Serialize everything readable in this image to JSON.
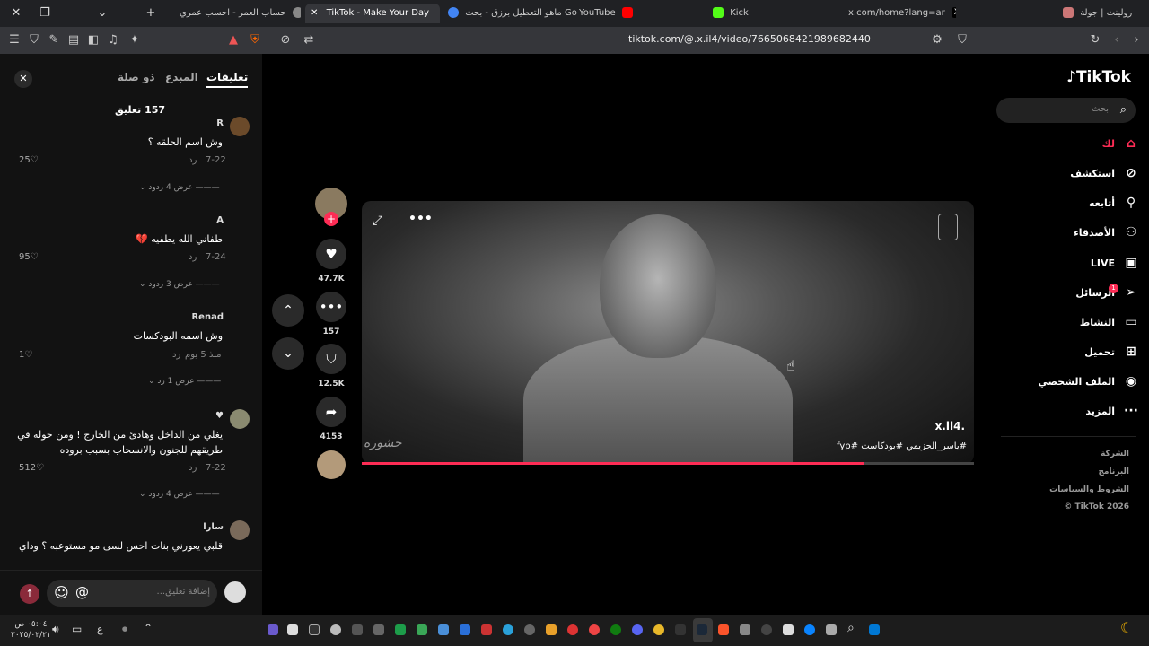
{
  "browser": {
    "tabs": [
      {
        "label": "رولينت | جولة",
        "icon": "globe-icon"
      },
      {
        "label": "x.com/home?lang=ar",
        "icon": "x-icon"
      },
      {
        "label": "Kick",
        "icon": "kick-icon"
      },
      {
        "label": "YouTube",
        "icon": "youtube-icon"
      },
      {
        "label": "ماهو التعطيل برزق - بحث Google",
        "icon": "google-icon"
      },
      {
        "label": "TikTok - Make Your Day",
        "icon": "tiktok-icon"
      },
      {
        "label": "حساب العمر - احسب عمري",
        "icon": "calculator-icon"
      }
    ],
    "url": "tiktok.com/@.x.il4/video/7665068421989682440"
  },
  "comments_panel": {
    "tabs": {
      "comments": "تعليقات",
      "creator": "المبدع",
      "related": "ذو صلة"
    },
    "count_label": "157 تعليق",
    "reply_label": "رد",
    "input_placeholder": "إضافة تعليق...",
    "items": [
      {
        "user": "R",
        "text": "وش اسم الحلقه ؟",
        "date": "7-22",
        "likes": "25",
        "replies": "عرض 4 ردود"
      },
      {
        "user": "A",
        "text": "طفاني الله يطفيه 💔",
        "date": "7-24",
        "likes": "95",
        "replies": "عرض 3 ردود"
      },
      {
        "user": "Renad",
        "text": "وش اسمه البودكسات",
        "date": "منذ 5 يوم",
        "likes": "1",
        "replies": "عرض 1 رد"
      },
      {
        "user": "♥",
        "text": "يغلي من الداخل وهادئ من الخارج ! ومن حوله في طريقهم للجنون والانسحاب بسبب بروده",
        "date": "7-22",
        "likes": "512",
        "replies": "عرض 4 ردود"
      },
      {
        "user": "سارا",
        "text": "قلبي يعورني بنات احس لسى مو مستوعبه ؟ وداي",
        "date": "",
        "likes": "",
        "replies": ""
      }
    ]
  },
  "video": {
    "author": "x.il4.",
    "caption": "#ياسر_الحزيمي #بودكاست #fyp",
    "watermark": "حشوره",
    "progress": 0.82,
    "likes": "47.7K",
    "comments": "157",
    "saves": "12.5K",
    "shares": "4153"
  },
  "sidebar": {
    "logo": "TikTok",
    "search_placeholder": "بحث",
    "nav": [
      {
        "label": "لك",
        "icon": "home-icon"
      },
      {
        "label": "استكشف",
        "icon": "compass-icon"
      },
      {
        "label": "أتابعه",
        "icon": "user-plus-icon"
      },
      {
        "label": "الأصدقاء",
        "icon": "friends-icon"
      },
      {
        "label": "LIVE",
        "icon": "live-icon"
      },
      {
        "label": "الرسائل",
        "icon": "send-icon"
      },
      {
        "label": "النشاط",
        "icon": "activity-icon"
      },
      {
        "label": "تحميل",
        "icon": "upload-icon"
      },
      {
        "label": "الملف الشخصي",
        "icon": "avatar-icon"
      },
      {
        "label": "المزيد",
        "icon": "more-icon"
      }
    ],
    "messages_badge": "1",
    "footer": [
      "الشركة",
      "البرنامج",
      "الشروط والسياسات",
      "© TikTok 2026"
    ]
  },
  "taskbar": {
    "time": "٠٥:٠٤ ص",
    "date": "٢٠٢٥/٠٢/٢١",
    "lang": "ع"
  },
  "colors": {
    "accent": "#fe2c55",
    "panel": "#121212",
    "bg": "#000000"
  }
}
